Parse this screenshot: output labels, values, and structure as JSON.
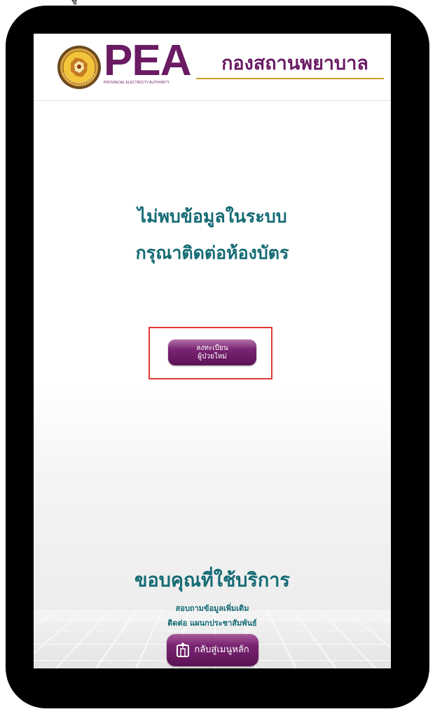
{
  "top_fragment": "ปู",
  "header": {
    "brand": "PEA",
    "brand_subtitle": "PROVINCIAL ELECTRICITY AUTHORITY",
    "department": "กองสถานพยาบาล",
    "seal_icon": "pea-seal-icon"
  },
  "message": {
    "line1": "ไม่พบข้อมูลในระบบ",
    "line2": "กรุณาติดต่อห้องบัตร"
  },
  "register_button": {
    "line1": "ลงทะเบียน",
    "line2": "ผู้ป่วยใหม่"
  },
  "footer": {
    "thanks": "ขอบคุณที่ใช้บริการ",
    "inquiry": "สอบถามข้อมูลเพิ่มเติม",
    "contact": "ติดต่อ แผนกประชาสัมพันธ์",
    "home_button": "กลับสู่เมนูหลัก",
    "home_icon": "exit-door-icon"
  },
  "colors": {
    "brand_purple": "#6a1b64",
    "text_teal": "#146b74",
    "highlight_red": "#e53935",
    "underline_gold": "#c9a227"
  }
}
